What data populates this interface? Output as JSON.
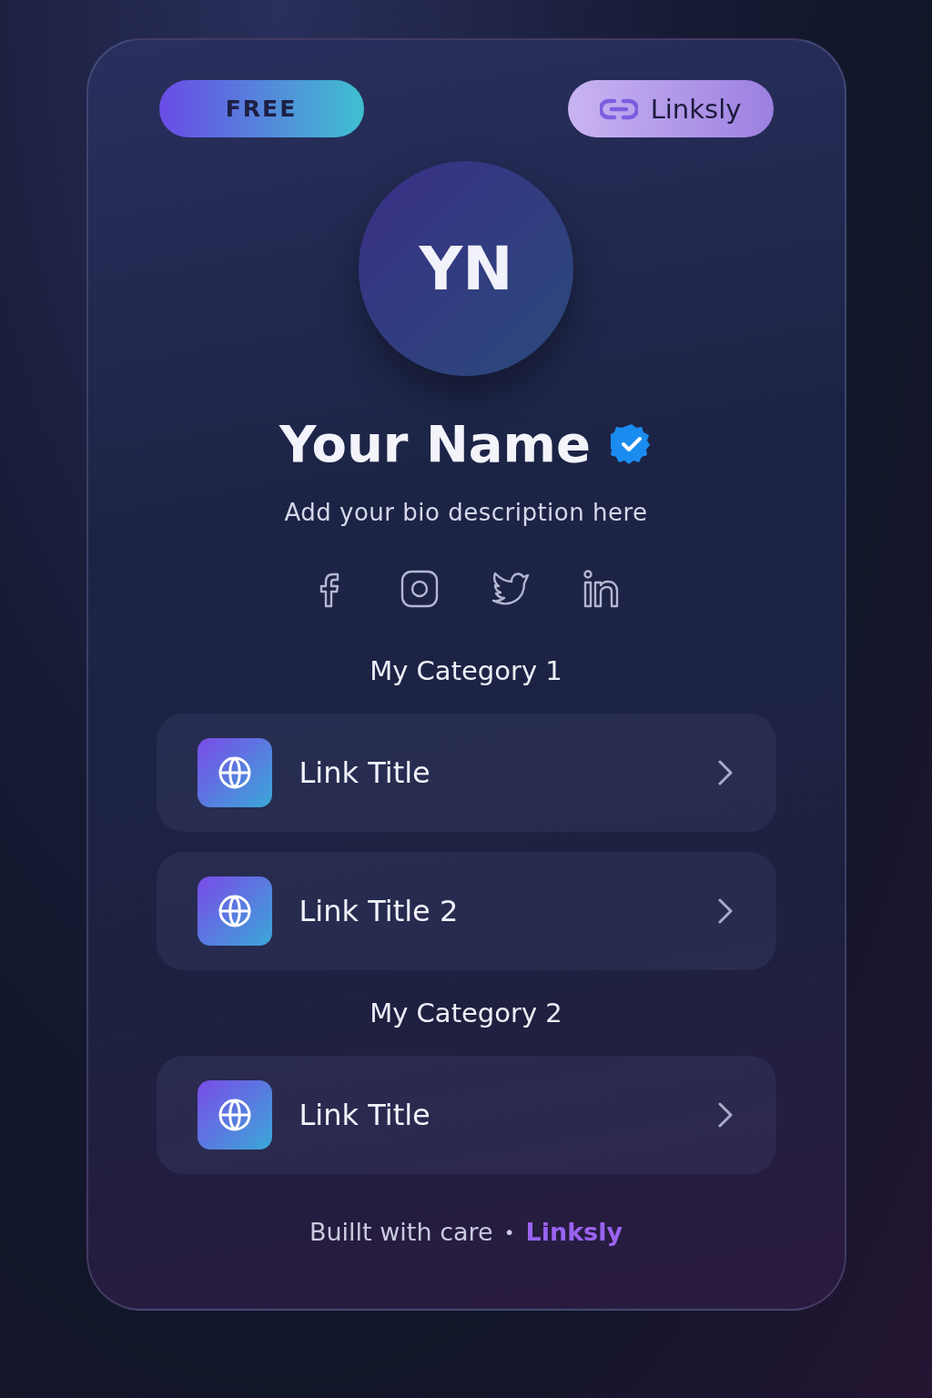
{
  "plan_badge": "FREE",
  "brand_badge": "Linksly",
  "avatar": {
    "initials": "YN"
  },
  "profile": {
    "name": "Your Name",
    "verified": true,
    "bio": "Add your bio description here"
  },
  "socials": [
    {
      "kind": "facebook"
    },
    {
      "kind": "instagram"
    },
    {
      "kind": "twitter"
    },
    {
      "kind": "linkedin"
    }
  ],
  "categories": [
    {
      "title": "My Category 1",
      "links": [
        {
          "title": "Link Title"
        },
        {
          "title": "Link Title 2"
        }
      ]
    },
    {
      "title": "My Category 2",
      "links": [
        {
          "title": "Link Title"
        }
      ]
    }
  ],
  "footer": {
    "text": "Buillt with care",
    "separator": "•",
    "brand": "Linksly"
  }
}
